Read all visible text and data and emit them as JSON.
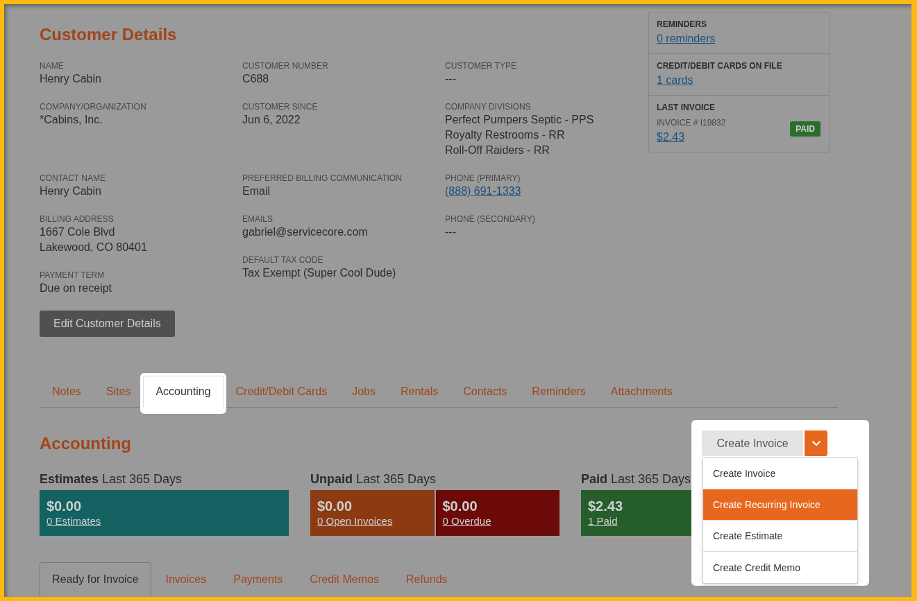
{
  "customer_details": {
    "title": "Customer Details",
    "sections": [
      {
        "columns": [
          [
            {
              "label": "NAME",
              "kind": "text",
              "lines": [
                "Henry Cabin"
              ]
            },
            {
              "label": "COMPANY/ORGANIZATION",
              "kind": "text",
              "lines": [
                "*Cabins, Inc."
              ]
            }
          ],
          [
            {
              "label": "CUSTOMER NUMBER",
              "kind": "text",
              "lines": [
                "C688"
              ]
            },
            {
              "label": "CUSTOMER SINCE",
              "kind": "text",
              "lines": [
                "Jun 6, 2022"
              ]
            }
          ],
          [
            {
              "label": "CUSTOMER TYPE",
              "kind": "text",
              "lines": [
                "---"
              ]
            },
            {
              "label": "COMPANY DIVISIONS",
              "kind": "text",
              "lines": [
                "Perfect Pumpers Septic - PPS",
                "Royalty Restrooms - RR",
                "Roll-Off Raiders - RR"
              ]
            }
          ]
        ]
      },
      {
        "columns": [
          [
            {
              "label": "CONTACT NAME",
              "kind": "text",
              "lines": [
                "Henry Cabin"
              ]
            },
            {
              "label": "BILLING ADDRESS",
              "kind": "text",
              "lines": [
                "1667 Cole Blvd",
                "Lakewood, CO 80401"
              ]
            },
            {
              "label": "PAYMENT TERM",
              "kind": "text",
              "lines": [
                "Due on receipt"
              ]
            }
          ],
          [
            {
              "label": "PREFERRED BILLING COMMUNICATION",
              "kind": "text",
              "lines": [
                "Email"
              ]
            },
            {
              "label": "EMAILS",
              "kind": "text",
              "lines": [
                "gabriel@servicecore.com"
              ]
            },
            {
              "label": "DEFAULT TAX CODE",
              "kind": "text",
              "lines": [
                "Tax Exempt (Super Cool Dude)"
              ]
            }
          ],
          [
            {
              "label": "PHONE (PRIMARY)",
              "kind": "link",
              "lines": [
                "(888) 691-1333"
              ]
            },
            {
              "label": "PHONE (SECONDARY)",
              "kind": "text",
              "lines": [
                "---"
              ]
            }
          ]
        ]
      }
    ],
    "edit_button": "Edit Customer Details"
  },
  "info_card": {
    "sections": [
      {
        "heading": "REMINDERS",
        "link": "0 reminders"
      },
      {
        "heading": "CREDIT/DEBIT CARDS ON FILE",
        "link": "1 cards"
      },
      {
        "heading": "LAST INVOICE",
        "caption": "INVOICE # I19832",
        "link": "$2.43",
        "badge": "PAID"
      }
    ]
  },
  "tabs": [
    {
      "label": "Notes",
      "selected": false
    },
    {
      "label": "Sites",
      "selected": false
    },
    {
      "label": "Accounting",
      "selected": true
    },
    {
      "label": "Credit/Debit Cards",
      "selected": false
    },
    {
      "label": "Jobs",
      "selected": false
    },
    {
      "label": "Rentals",
      "selected": false
    },
    {
      "label": "Contacts",
      "selected": false
    },
    {
      "label": "Reminders",
      "selected": false
    },
    {
      "label": "Attachments",
      "selected": false
    }
  ],
  "accounting": {
    "title": "Accounting",
    "create_button": {
      "label": "Create Invoice",
      "expanded": true
    },
    "menu": [
      {
        "label": "Create Invoice",
        "selected": false
      },
      {
        "label": "Create Recurring Invoice",
        "selected": true
      },
      {
        "label": "Create Estimate",
        "selected": false
      },
      {
        "label": "Create Credit Memo",
        "selected": false
      }
    ],
    "summary": [
      {
        "heading": "**Estimates** Last 365 Days",
        "cards": [
          {
            "amount": "$0.00",
            "link": "0 Estimates",
            "color": "#136161"
          }
        ]
      },
      {
        "heading": "**Unpaid** Last 365 Days",
        "cards": [
          {
            "amount": "$0.00",
            "link": "0 Open Invoices",
            "color": "#8b3a12"
          },
          {
            "amount": "$0.00",
            "link": "0 Overdue",
            "color": "#6c0a0a"
          }
        ]
      },
      {
        "heading": "**Paid** Last 365 Days",
        "cards": [
          {
            "amount": "$2.43",
            "link": "1 Paid",
            "color": "#255e2a"
          }
        ]
      }
    ],
    "subtabs": [
      {
        "label": "Ready for Invoice",
        "selected": true
      },
      {
        "label": "Invoices",
        "selected": false
      },
      {
        "label": "Payments",
        "selected": false
      },
      {
        "label": "Credit Memos",
        "selected": false
      },
      {
        "label": "Refunds",
        "selected": false
      }
    ]
  }
}
